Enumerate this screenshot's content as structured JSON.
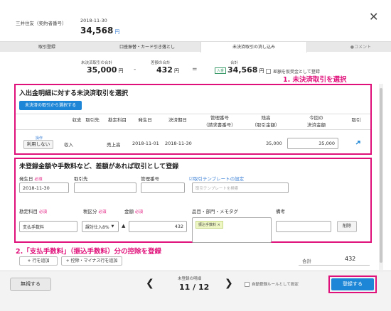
{
  "header": {
    "account": "三井住友（契約者番号）",
    "date": "2018-11-30",
    "amount": "34,568",
    "currency": "円",
    "close_icon": "close-icon"
  },
  "tabs": [
    {
      "label": "取引登録"
    },
    {
      "label": "口座振替・カード引き落とし"
    },
    {
      "label": "未決済取引の消し込み"
    },
    {
      "label": "●コメント"
    }
  ],
  "summary": {
    "unsettled_label": "未決済取引の合計",
    "unsettled_value": "35,000",
    "diff_label": "差額の合計",
    "diff_value": "432",
    "total_label": "合計",
    "total_badge": "入金",
    "total_value": "34,568",
    "yen": "円",
    "minus": "-",
    "equals": "=",
    "checkbox_label": "差額を仮受金として登録"
  },
  "annotations": {
    "step1": "1. 未決済取引を選択",
    "step2": "2.「支払手数料」（振込手数料）分の控除を登録"
  },
  "section1": {
    "title": "入出金明細に対する未決済取引を選択",
    "select_button": "未決済の取引から選択する",
    "columns": [
      "収支",
      "取引先",
      "勘定科目",
      "発生日",
      "決済期日",
      "管理番号",
      "（請求書番号）",
      "残高",
      "（取引金額）",
      "今回の",
      "決済金額",
      "取引"
    ],
    "row": {
      "small_label": "操作",
      "unuse_button": "利用しない",
      "type": "収入",
      "partner": "",
      "account": "売上高",
      "issue_date": "2018-11-01",
      "due_date": "2018-11-30",
      "balance": "35,000",
      "settle_amount": "35,000"
    }
  },
  "section2": {
    "title": "未登録金額や手数料など、差額があれば取引として登録",
    "date_label": "発生日",
    "required": "必須",
    "date_value": "2018-11-30",
    "partner_label": "取引先",
    "mgmt_label": "管理番号",
    "template_link": "☑取引テンプレートの設定",
    "template_placeholder": "取引テンプレートを検索",
    "account_label": "勘定科目",
    "tax_label": "税区分",
    "amount_label": "金額",
    "item_label": "品目・部門・メモタグ",
    "note_label": "備考",
    "account_value": "支払手数料",
    "tax_value": "課対仕入8%",
    "sign": "▲",
    "amount_value": "432",
    "tag_value": "振込手数料 ×",
    "delete_button": "削除",
    "add_row": "+ 行を追加",
    "add_deduct": "+ 控除・マイナス行を追加",
    "total_label": "合計",
    "total_value": "432"
  },
  "footer": {
    "ignore_button": "無視する",
    "pager_label": "未登録の明細",
    "pager": "11 / 12",
    "auto_rule": "自動登録ルールとして設定",
    "register_button": "登録する"
  },
  "colors": {
    "accent": "#e0107a",
    "primary": "#1d86d6"
  }
}
